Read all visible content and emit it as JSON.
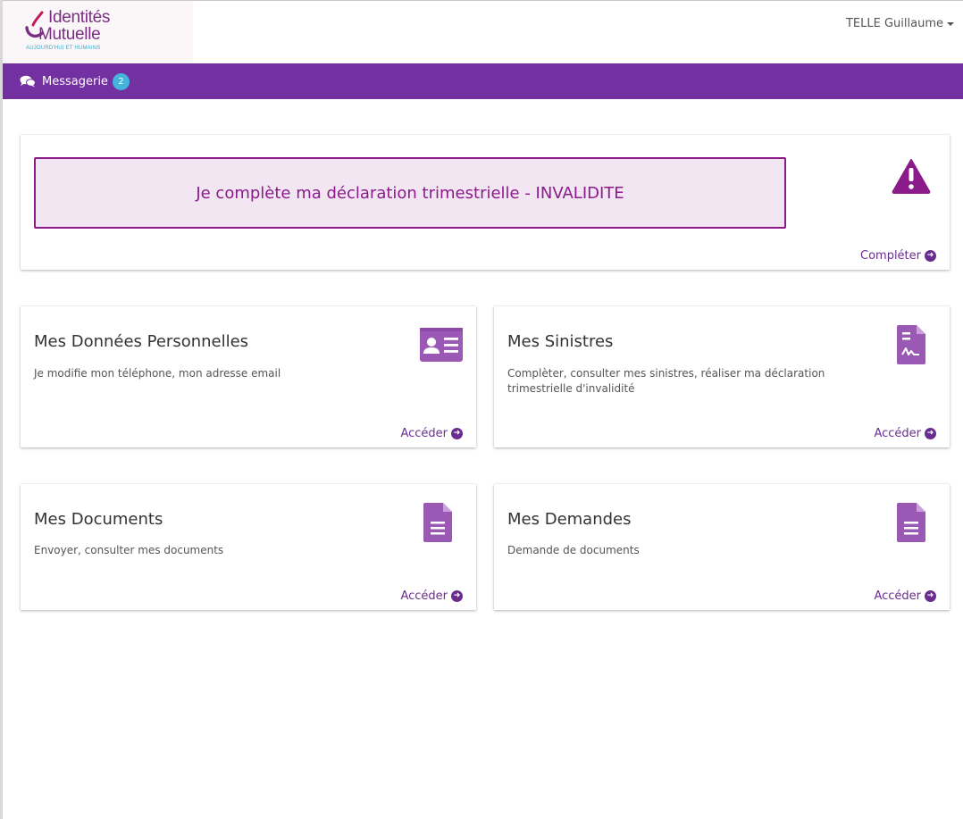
{
  "header": {
    "logo": {
      "line1": "Identités",
      "line2": "Mutuelle",
      "tagline": "AUJOURD'HUI ET HUMAINS"
    },
    "user_name": "TELLE Guillaume"
  },
  "nav": {
    "messagerie_label": "Messagerie",
    "messagerie_count": "2"
  },
  "alert": {
    "text": "Je complète ma déclaration trimestrielle - INVALIDITE",
    "link_label": "Compléter",
    "icon": "warning-triangle-icon"
  },
  "tiles": [
    {
      "title": "Mes Données Personnelles",
      "description": "Je modifie mon téléphone, mon adresse email",
      "link_label": "Accéder",
      "icon": "id-card-icon"
    },
    {
      "title": "Mes Sinistres",
      "description": "Complèter, consulter mes sinistres, réaliser ma déclaration trimestrielle d'invalidité",
      "link_label": "Accéder",
      "icon": "file-signature-icon"
    },
    {
      "title": "Mes Documents",
      "description": "Envoyer, consulter mes documents",
      "link_label": "Accéder",
      "icon": "file-text-icon"
    },
    {
      "title": "Mes Demandes",
      "description": "Demande de documents",
      "link_label": "Accéder",
      "icon": "file-text-icon"
    }
  ],
  "colors": {
    "brand_purple": "#7230a0",
    "icon_purple": "#9b59b6",
    "alert_magenta": "#8b1a8b",
    "badge_blue": "#44b4dd"
  }
}
